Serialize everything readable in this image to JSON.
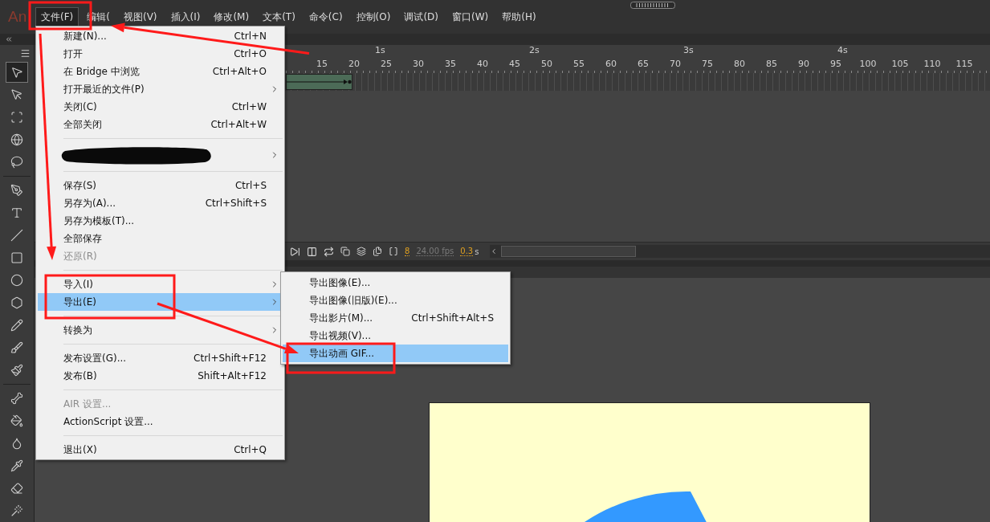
{
  "app": {
    "logo": "An"
  },
  "menu_bar": [
    {
      "label": "文件(F)",
      "selected": true
    },
    {
      "label": "编辑(",
      "selected": false
    },
    {
      "label": "视图(V)",
      "selected": false
    },
    {
      "label": "插入(I)",
      "selected": false
    },
    {
      "label": "修改(M)",
      "selected": false
    },
    {
      "label": "文本(T)",
      "selected": false
    },
    {
      "label": "命令(C)",
      "selected": false
    },
    {
      "label": "控制(O)",
      "selected": false
    },
    {
      "label": "调试(D)",
      "selected": false
    },
    {
      "label": "窗口(W)",
      "selected": false
    },
    {
      "label": "帮助(H)",
      "selected": false
    }
  ],
  "tools": [
    {
      "kind": "selection",
      "selected": true
    },
    {
      "kind": "subselection",
      "selected": false
    },
    {
      "kind": "free_transform",
      "selected": false
    },
    {
      "kind": "rotate_3d",
      "selected": false
    },
    {
      "kind": "lasso",
      "selected": false
    },
    {
      "kind": "separator"
    },
    {
      "kind": "pen",
      "selected": false
    },
    {
      "kind": "text",
      "selected": false
    },
    {
      "kind": "line",
      "selected": false
    },
    {
      "kind": "rectangle",
      "selected": false
    },
    {
      "kind": "oval",
      "selected": false
    },
    {
      "kind": "polystar",
      "selected": false
    },
    {
      "kind": "pencil",
      "selected": false
    },
    {
      "kind": "brush",
      "selected": false
    },
    {
      "kind": "paint_brush",
      "selected": false
    },
    {
      "kind": "separator"
    },
    {
      "kind": "bone",
      "selected": false
    },
    {
      "kind": "paint_bucket",
      "selected": false
    },
    {
      "kind": "ink_bottle",
      "selected": false
    },
    {
      "kind": "eyedropper",
      "selected": false
    },
    {
      "kind": "eraser",
      "selected": false
    },
    {
      "kind": "width",
      "selected": false
    }
  ],
  "timeline": {
    "seconds": [
      "1s",
      "2s",
      "3s",
      "4s"
    ],
    "frames": [
      "15",
      "20",
      "25",
      "30",
      "35",
      "40",
      "45",
      "50",
      "55",
      "60",
      "65",
      "70",
      "75",
      "80",
      "85",
      "90",
      "95",
      "100",
      "105",
      "110",
      "115"
    ],
    "current_frame": "8",
    "fps": "24.00 fps",
    "time": "0.3",
    "time_unit": "s"
  },
  "file_menu": [
    {
      "kind": "item",
      "label": "新建(N)...",
      "shortcut": "Ctrl+N",
      "submenu": false,
      "disabled": false,
      "selected": false
    },
    {
      "kind": "item",
      "label": "打开",
      "shortcut": "Ctrl+O",
      "submenu": false,
      "disabled": false,
      "selected": false
    },
    {
      "kind": "item",
      "label": "在 Bridge 中浏览",
      "shortcut": "Ctrl+Alt+O",
      "submenu": false,
      "disabled": false,
      "selected": false
    },
    {
      "kind": "item",
      "label": "打开最近的文件(P)",
      "submenu": true,
      "disabled": false,
      "selected": false
    },
    {
      "kind": "item",
      "label": "关闭(C)",
      "shortcut": "Ctrl+W",
      "submenu": false,
      "disabled": false,
      "selected": false
    },
    {
      "kind": "item",
      "label": "全部关闭",
      "shortcut": "Ctrl+Alt+W",
      "submenu": false,
      "disabled": false,
      "selected": false
    },
    {
      "kind": "separator"
    },
    {
      "kind": "redacted",
      "submenu": true
    },
    {
      "kind": "separator"
    },
    {
      "kind": "item",
      "label": "保存(S)",
      "shortcut": "Ctrl+S",
      "submenu": false,
      "disabled": false,
      "selected": false
    },
    {
      "kind": "item",
      "label": "另存为(A)...",
      "shortcut": "Ctrl+Shift+S",
      "submenu": false,
      "disabled": false,
      "selected": false
    },
    {
      "kind": "item",
      "label": "另存为模板(T)...",
      "submenu": false,
      "disabled": false,
      "selected": false
    },
    {
      "kind": "item",
      "label": "全部保存",
      "submenu": false,
      "disabled": false,
      "selected": false
    },
    {
      "kind": "item",
      "label": "还原(R)",
      "submenu": false,
      "disabled": true,
      "selected": false
    },
    {
      "kind": "separator"
    },
    {
      "kind": "item",
      "label": "导入(I)",
      "submenu": true,
      "disabled": false,
      "selected": false
    },
    {
      "kind": "item",
      "label": "导出(E)",
      "submenu": true,
      "disabled": false,
      "selected": true
    },
    {
      "kind": "separator"
    },
    {
      "kind": "item",
      "label": "转换为",
      "submenu": true,
      "disabled": false,
      "selected": false
    },
    {
      "kind": "separator"
    },
    {
      "kind": "item",
      "label": "发布设置(G)...",
      "shortcut": "Ctrl+Shift+F12",
      "submenu": false,
      "disabled": false,
      "selected": false
    },
    {
      "kind": "item",
      "label": "发布(B)",
      "shortcut": "Shift+Alt+F12",
      "submenu": false,
      "disabled": false,
      "selected": false
    },
    {
      "kind": "separator"
    },
    {
      "kind": "item",
      "label": "AIR 设置...",
      "submenu": false,
      "disabled": true,
      "selected": false
    },
    {
      "kind": "item",
      "label": "ActionScript 设置...",
      "submenu": false,
      "disabled": false,
      "selected": false
    },
    {
      "kind": "separator"
    },
    {
      "kind": "item",
      "label": "退出(X)",
      "shortcut": "Ctrl+Q",
      "submenu": false,
      "disabled": false,
      "selected": false
    }
  ],
  "export_submenu": [
    {
      "label": "导出图像(E)...",
      "selected": false
    },
    {
      "label": "导出图像(旧版)(E)...",
      "selected": false
    },
    {
      "label": "导出影片(M)...",
      "shortcut": "Ctrl+Shift+Alt+S",
      "selected": false
    },
    {
      "label": "导出视频(V)...",
      "selected": false
    },
    {
      "label": "导出动画 GIF...",
      "selected": true
    }
  ]
}
